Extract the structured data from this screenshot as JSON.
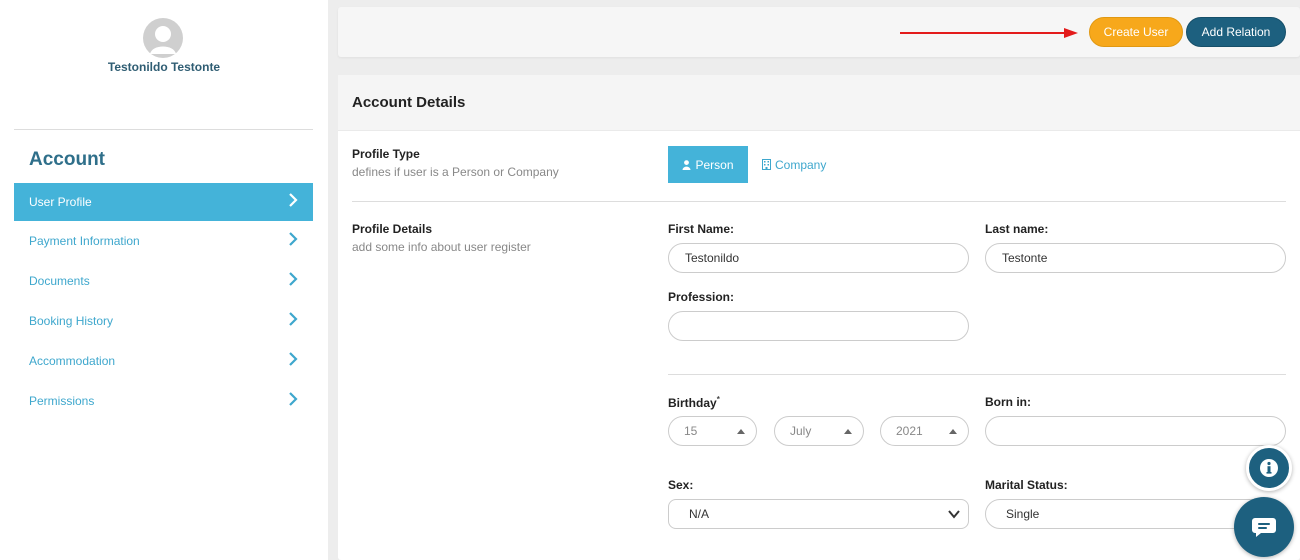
{
  "user": {
    "name": "Testonildo Testonte"
  },
  "sidebar": {
    "heading": "Account",
    "items": [
      {
        "label": "User Profile",
        "active": true
      },
      {
        "label": "Payment Information"
      },
      {
        "label": "Documents"
      },
      {
        "label": "Booking History"
      },
      {
        "label": "Accommodation"
      },
      {
        "label": "Permissions"
      }
    ]
  },
  "topbar": {
    "create_label": "Create User",
    "relation_label": "Add Relation"
  },
  "panel": {
    "title": "Account Details",
    "profile_type": {
      "title": "Profile Type",
      "subtitle": "defines if user is a Person or Company",
      "options": [
        "Person",
        "Company"
      ],
      "selected": "Person"
    },
    "profile_details": {
      "title": "Profile Details",
      "subtitle": "add some info about user register"
    },
    "fields": {
      "first_name_label": "First Name:",
      "first_name_value": "Testonildo",
      "last_name_label": "Last name:",
      "last_name_value": "Testonte",
      "profession_label": "Profession:",
      "profession_value": "",
      "birthday_label": "Birthday",
      "birthday_required": "*",
      "birthday_day": "15",
      "birthday_month": "July",
      "birthday_year": "2021",
      "born_in_label": "Born in:",
      "born_in_value": "",
      "sex_label": "Sex:",
      "sex_value": "N/A",
      "marital_label": "Marital Status:",
      "marital_value": "Single"
    }
  },
  "colors": {
    "accent": "#44b3d9",
    "primary": "#1d607f",
    "warning": "#f7a81b"
  },
  "icons": [
    "avatar-icon",
    "chevron-right-icon",
    "person-icon",
    "building-icon",
    "info-icon",
    "chat-icon",
    "arrow-right-icon"
  ]
}
